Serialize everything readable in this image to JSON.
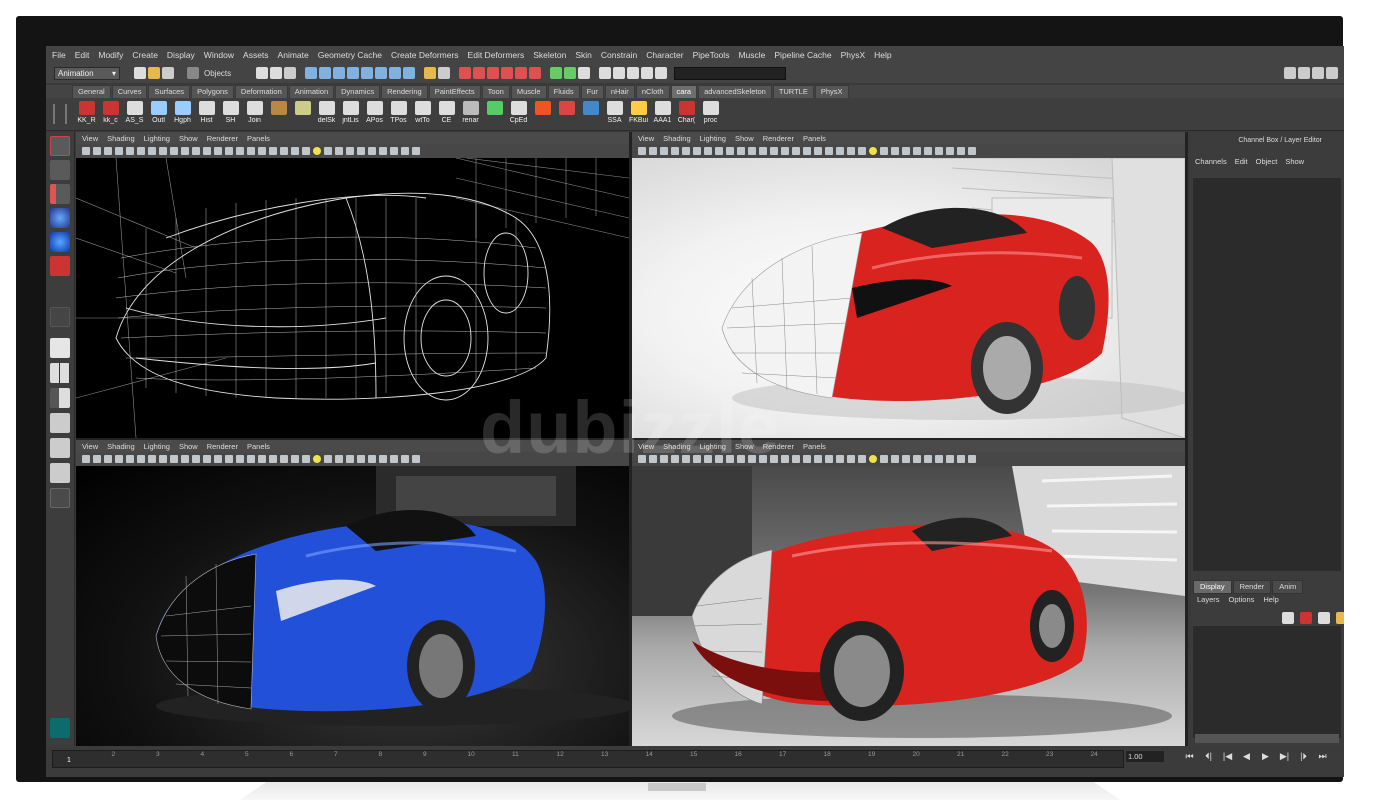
{
  "menu": [
    "File",
    "Edit",
    "Modify",
    "Create",
    "Display",
    "Window",
    "Assets",
    "Animate",
    "Geometry Cache",
    "Create Deformers",
    "Edit Deformers",
    "Skeleton",
    "Skin",
    "Constrain",
    "Character",
    "PipeTools",
    "Muscle",
    "Pipeline Cache",
    "PhysX",
    "Help"
  ],
  "statusline": {
    "mode": "Animation",
    "select": "Objects"
  },
  "shelf_tabs": [
    "General",
    "Curves",
    "Surfaces",
    "Polygons",
    "Deformation",
    "Animation",
    "Dynamics",
    "Rendering",
    "PaintEffects",
    "Toon",
    "Muscle",
    "Fluids",
    "Fur",
    "nHair",
    "nCloth",
    "cara",
    "advancedSkeleton",
    "TURTLE",
    "PhysX"
  ],
  "active_shelf_tab": "cara",
  "shelf_buttons": [
    "KK_R",
    "kk_c",
    "AS_S",
    "Outl",
    "Hgph",
    "Hist",
    "SH",
    "Join",
    "",
    "",
    "delSk",
    "jntLis",
    "APos",
    "TPos",
    "wtTo",
    "CE",
    "renar",
    "",
    "CpEd",
    "",
    "",
    "",
    "SSA",
    "FKBui",
    "AAA1",
    "Char(",
    "proc"
  ],
  "shelf_colors": [
    "#c33",
    "#c33",
    "#ddd",
    "#9cf",
    "#9cf",
    "#ddd",
    "#ddd",
    "#ddd",
    "#b84",
    "#cc8",
    "#ddd",
    "#ddd",
    "#ddd",
    "#ddd",
    "#ddd",
    "#ddd",
    "#bbb",
    "#5c6",
    "#ddd",
    "#e52",
    "#d44",
    "#48c",
    "#ddd",
    "#fc4",
    "#ddd",
    "#c33",
    "#ddd"
  ],
  "viewport_menu": [
    "View",
    "Shading",
    "Lighting",
    "Show",
    "Renderer",
    "Panels"
  ],
  "channel_box": {
    "title": "Channel Box / Layer Editor",
    "menu": [
      "Channels",
      "Edit",
      "Object",
      "Show"
    ],
    "layer_tabs": [
      "Display",
      "Render",
      "Anim"
    ],
    "layer_menu": [
      "Layers",
      "Options",
      "Help"
    ]
  },
  "timeline": {
    "ticks": [
      "1",
      "2",
      "3",
      "4",
      "5",
      "6",
      "7",
      "8",
      "9",
      "10",
      "11",
      "12",
      "13",
      "14",
      "15",
      "16",
      "17",
      "18",
      "19",
      "20",
      "21",
      "22",
      "23",
      "24"
    ],
    "current_frame": "1.00",
    "controls": [
      "⏮",
      "⏴|",
      "|◀",
      "◀",
      "▶",
      "▶|",
      "|⏵",
      "⏭"
    ]
  },
  "watermark": "dubizzle",
  "colors": {
    "red_car": "#d8231f",
    "blue_car": "#2350d8",
    "bg_dark": "#3a3a3a"
  }
}
